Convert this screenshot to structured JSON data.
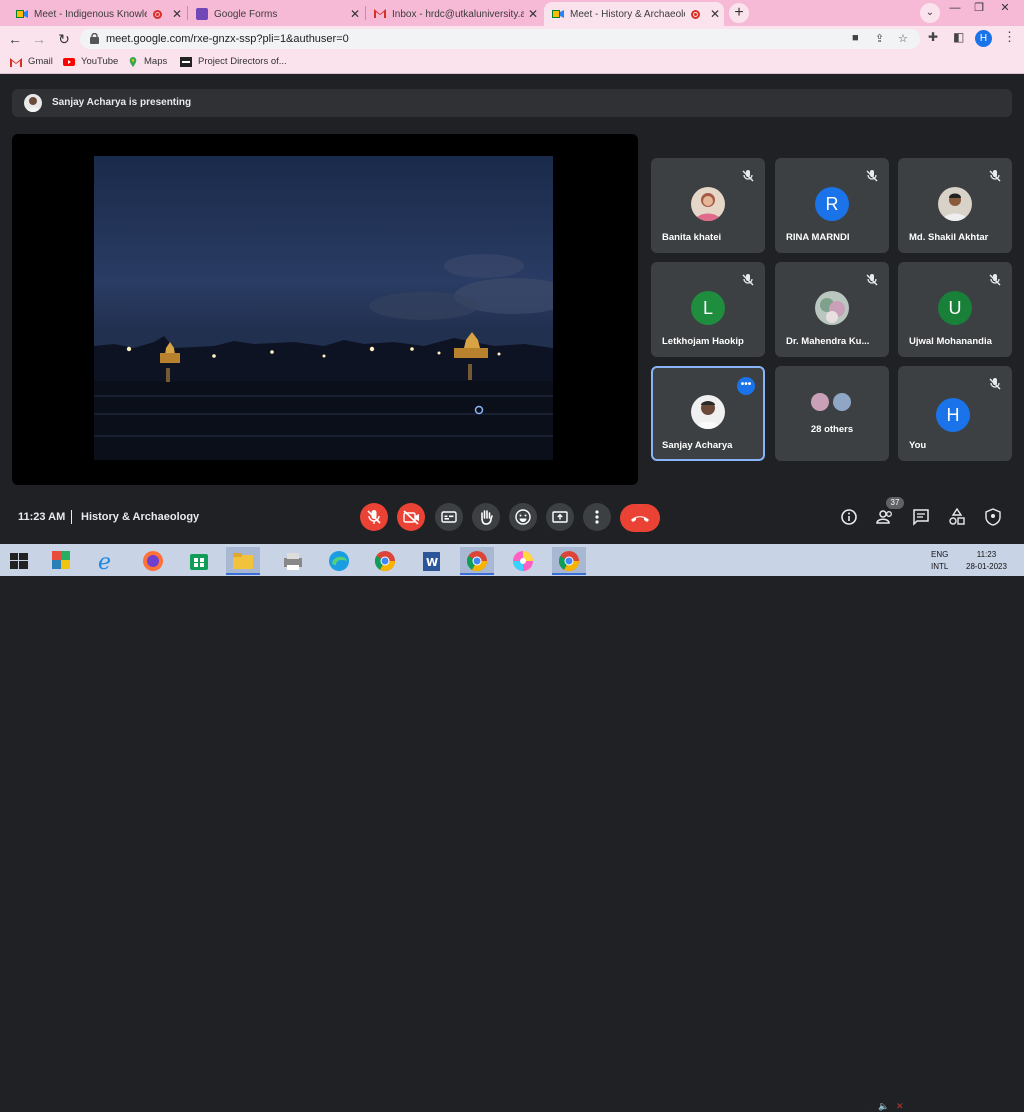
{
  "browser": {
    "tabs": [
      {
        "title": "Meet - Indigenous Knowledg",
        "recording": true,
        "active": false
      },
      {
        "title": "Google Forms",
        "recording": false,
        "active": false
      },
      {
        "title": "Inbox - hrdc@utkaluniversity.ac.i",
        "recording": false,
        "active": false
      },
      {
        "title": "Meet - History & Archaeolog",
        "recording": true,
        "active": true
      }
    ],
    "new_tab_label": "+",
    "url": "meet.google.com/rxe-gnzx-ssp?pli=1&authuser=0",
    "profile_initial": "H",
    "bookmarks": [
      {
        "label": "Gmail",
        "icon": "gmail-icon"
      },
      {
        "label": "YouTube",
        "icon": "youtube-icon"
      },
      {
        "label": "Maps",
        "icon": "maps-icon"
      },
      {
        "label": "Project Directors of...",
        "icon": "sbm-icon"
      }
    ]
  },
  "meet": {
    "presenting_banner": "Sanjay Acharya is presenting",
    "participants": [
      {
        "name": "Banita khatei",
        "avatar": "photo",
        "muted": true
      },
      {
        "name": "RINA MARNDI",
        "avatar": "R",
        "avatar_color": "#1a73e8",
        "muted": true
      },
      {
        "name": "Md. Shakil Akhtar",
        "avatar": "photo",
        "muted": true
      },
      {
        "name": "Letkhojam Haokip",
        "avatar": "L",
        "avatar_color": "#1e8e3e",
        "muted": true
      },
      {
        "name": "Dr. Mahendra Ku...",
        "avatar": "photo",
        "muted": true
      },
      {
        "name": "Ujwal Mohanandia",
        "avatar": "U",
        "avatar_color": "#188038",
        "muted": true
      },
      {
        "name": "Sanjay Acharya",
        "avatar": "photo",
        "muted": false,
        "presenting": true
      },
      {
        "name": "28 others",
        "avatar": "group",
        "muted": false
      },
      {
        "name": "You",
        "avatar": "H",
        "avatar_color": "#1a73e8",
        "muted": true
      }
    ],
    "more_options": "•••",
    "time": "11:23 AM",
    "meeting_name": "History & Archaeology",
    "participant_count": "37"
  },
  "taskbar": {
    "lang_line1": "ENG",
    "lang_line2": "INTL",
    "time": "11:23",
    "date": "28-01-2023"
  },
  "colors": {
    "tabbar": "#f6b9d6",
    "meet_bg": "#202124",
    "tile_bg": "#3c4043",
    "red": "#ea4335",
    "accent": "#1a73e8"
  }
}
